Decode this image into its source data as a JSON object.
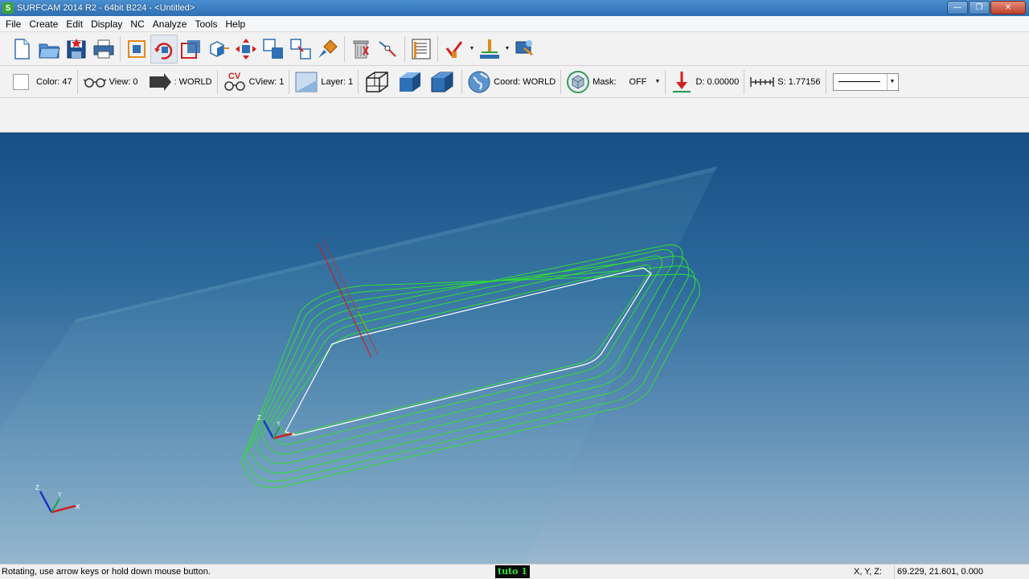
{
  "window": {
    "app_letter": "S",
    "title": "SURFCAM 2014 R2 - 64bit B224 - <Untitled>",
    "minimize_glyph": "—",
    "maximize_glyph": "❐",
    "close_glyph": "✕"
  },
  "menu": [
    "File",
    "Create",
    "Edit",
    "Display",
    "NC",
    "Analyze",
    "Tools",
    "Help"
  ],
  "toolbar_icons": [
    "new-file-icon",
    "open-folder-icon",
    "save-icon",
    "print-icon",
    "zoom-fit-icon",
    "rotate-view-icon",
    "zoom-window-icon",
    "zoom-box-icon",
    "pan-icon",
    "copy-icon",
    "move-icon",
    "paint-brush-icon",
    "trash-icon",
    "select-icon",
    "nc-list-icon",
    "nc-operation-icon",
    "tool-icon",
    "post-process-icon"
  ],
  "settings_bar": {
    "color_label": "Color: 47",
    "view_label": "View: 0",
    "world_label": ": WORLD",
    "cview_badge": "CV",
    "cview_label": "CView: 1",
    "layer_label": "Layer: 1",
    "coord_label": "Coord: WORLD",
    "mask_label": "Mask:",
    "mask_value": "OFF",
    "depth_label": "D: 0.00000",
    "scale_label": "S: 1.77156"
  },
  "viewport": {
    "origin_axis_labels": {
      "z": "Z",
      "y": "Y",
      "x": "X"
    },
    "corner_axis_labels": {
      "z": "Z",
      "y": "Y",
      "x": "X"
    }
  },
  "status": {
    "message": "Rotating, use arrow keys or hold down mouse button.",
    "badge": "tuto 1",
    "xyz_label": "X, Y, Z:",
    "xyz_value": "69.229, 21.601, 0.000"
  },
  "colors": {
    "toolpath": "#2fe02f",
    "contour": "#ffffff",
    "tool_axis": "#cc2020",
    "viewport_top": "#154f85",
    "viewport_bottom": "#9ab8cf"
  }
}
